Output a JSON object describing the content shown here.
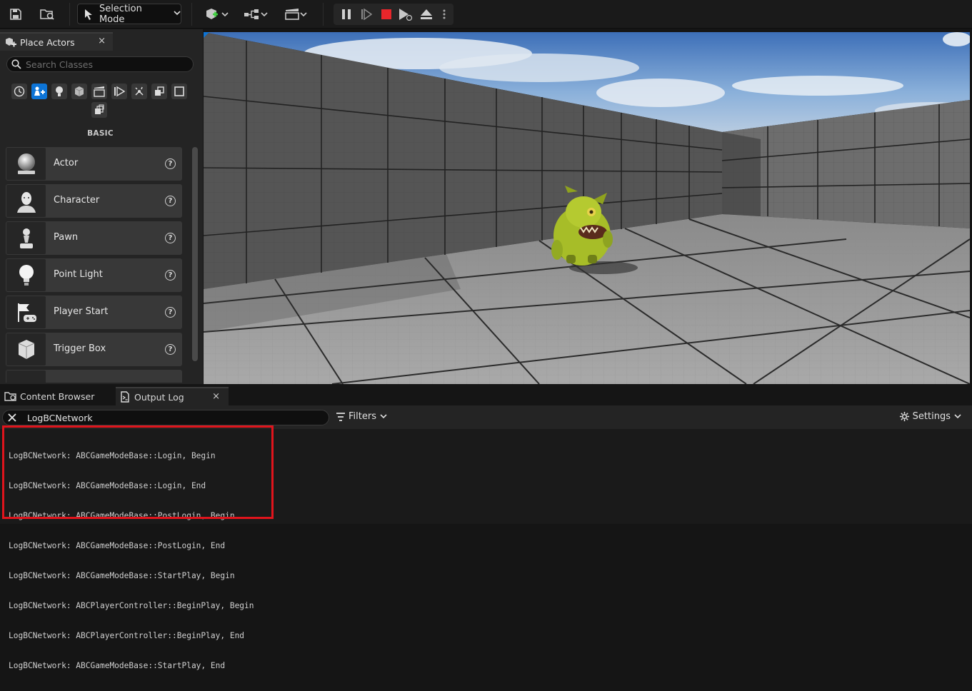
{
  "toolbar": {
    "selection_mode_label": "Selection Mode"
  },
  "place_actors": {
    "tab_label": "Place Actors",
    "close_glyph": "×",
    "search_placeholder": "Search Classes",
    "category_heading": "BASIC",
    "categories": [
      "recent",
      "basic",
      "lights",
      "shapes",
      "cinematic",
      "visual-effects",
      "volumes",
      "all-classes",
      "geometry",
      "other"
    ],
    "items": [
      {
        "label": "Actor",
        "icon": "sphere-icon"
      },
      {
        "label": "Character",
        "icon": "character-icon"
      },
      {
        "label": "Pawn",
        "icon": "pawn-icon"
      },
      {
        "label": "Point Light",
        "icon": "light-bulb-icon"
      },
      {
        "label": "Player Start",
        "icon": "player-start-icon"
      },
      {
        "label": "Trigger Box",
        "icon": "trigger-box-icon"
      }
    ],
    "help_glyph": "?"
  },
  "bottom_panel": {
    "tabs": [
      {
        "label": "Content Browser"
      },
      {
        "label": "Output Log",
        "active": true
      }
    ],
    "close_glyph": "×",
    "filter_value": "LogBCNetwork",
    "filters_label": "Filters",
    "settings_label": "Settings",
    "log_lines": [
      "LogBCNetwork: ABCGameModeBase::Login, Begin",
      "LogBCNetwork: ABCGameModeBase::Login, End",
      "LogBCNetwork: ABCGameModeBase::PostLogin, Begin",
      "LogBCNetwork: ABCGameModeBase::PostLogin, End",
      "LogBCNetwork: ABCGameModeBase::StartPlay, Begin",
      "LogBCNetwork: ABCPlayerController::BeginPlay, Begin",
      "LogBCNetwork: ABCPlayerController::BeginPlay, End",
      "LogBCNetwork: ABCGameModeBase::StartPlay, End"
    ]
  },
  "colors": {
    "accent": "#0d74d6",
    "stop_red": "#e8262b",
    "highlight_red": "#e0141c"
  }
}
